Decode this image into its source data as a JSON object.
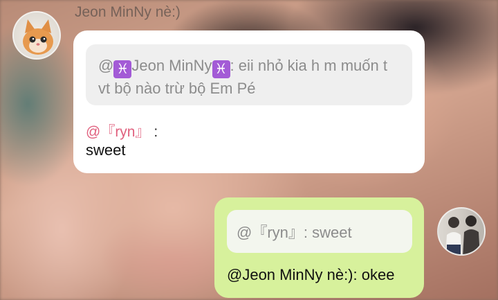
{
  "chat": {
    "incoming": {
      "sender_name": "Jeon MinNy nè:)",
      "quote": {
        "prefix": "@",
        "pisces_symbol": "♓",
        "name": "Jeon MinNy",
        "text": ": eii nhỏ kia h m muốn t vt bộ nào trừ bộ Em Pé"
      },
      "mention": "@『ryn』",
      "mention_colon": " :",
      "message": "sweet"
    },
    "outgoing": {
      "quote": "@『ryn』: sweet",
      "message": "@Jeon MinNy nè:): okee"
    }
  },
  "colors": {
    "incoming_bubble": "#ffffff",
    "outgoing_bubble": "#d7f19c",
    "mention": "#e0607e",
    "pisces_badge": "#a35bd6"
  },
  "icons": {
    "left_avatar": "cat-avatar",
    "right_avatar": "couple-photo-avatar"
  }
}
